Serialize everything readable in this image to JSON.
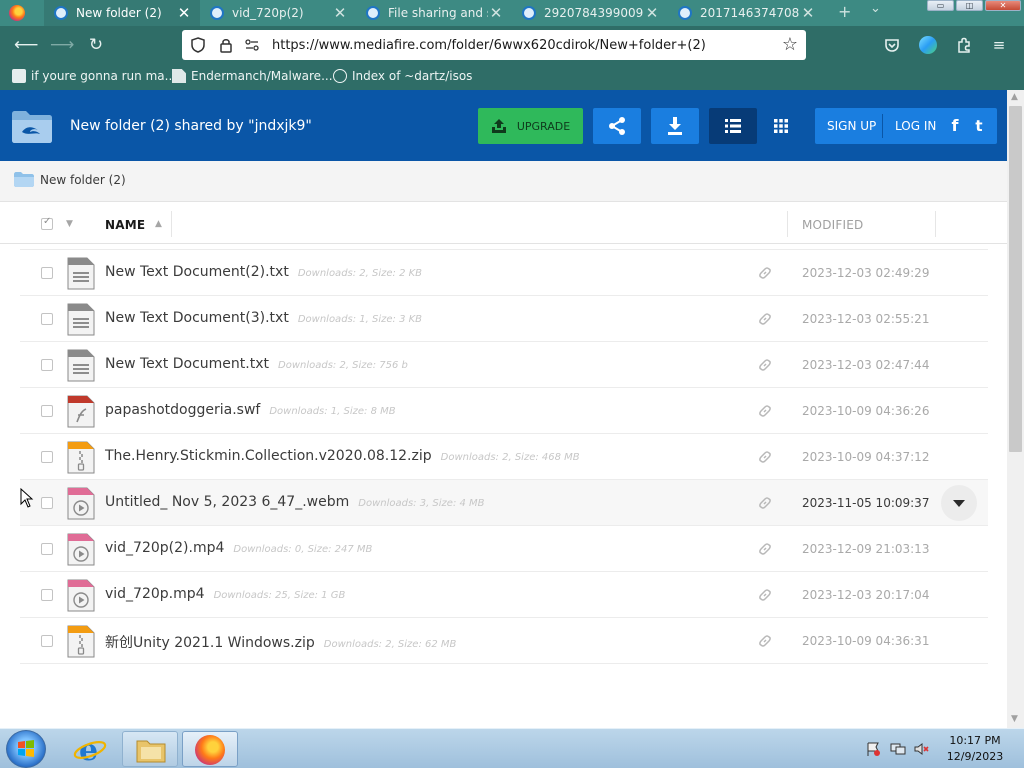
{
  "browser": {
    "tabs": [
      {
        "label": "New folder (2)",
        "active": true
      },
      {
        "label": "vid_720p(2)",
        "active": false
      },
      {
        "label": "File sharing and st",
        "active": false
      },
      {
        "label": "2920784399009",
        "active": false
      },
      {
        "label": "2017146374708",
        "active": false
      }
    ],
    "new_tab": "+",
    "tab_list": "⌄",
    "url": "https://www.mediafire.com/folder/6wwx620cdirok/New+folder+(2)",
    "bookmarks": [
      {
        "label": "if youre gonna run ma..."
      },
      {
        "label": "Endermanch/Malware..."
      },
      {
        "label": "Index of ~dartz/isos"
      }
    ],
    "window_buttons": {
      "minimize": "▭",
      "maximize": "◫",
      "close": "✕"
    }
  },
  "header": {
    "title": "New folder (2)   shared by \"jndxjk9\"",
    "upgrade_label": "UPGRADE",
    "sign_up": "SIGN UP",
    "log_in": "LOG IN",
    "facebook": "f",
    "twitter": "t"
  },
  "breadcrumb": {
    "label": "New folder (2)"
  },
  "columns": {
    "name": "NAME",
    "modified": "MODIFIED"
  },
  "files": [
    {
      "name": "New Text Document(2).txt",
      "meta": "Downloads: 2, Size: 2 KB",
      "modified": "2023-12-03 02:49:29",
      "type": "txt"
    },
    {
      "name": "New Text Document(3).txt",
      "meta": "Downloads: 1, Size: 3 KB",
      "modified": "2023-12-03 02:55:21",
      "type": "txt"
    },
    {
      "name": "New Text Document.txt",
      "meta": "Downloads: 2, Size: 756 b",
      "modified": "2023-12-03 02:47:44",
      "type": "txt"
    },
    {
      "name": "papashotdoggeria.swf",
      "meta": "Downloads: 1, Size: 8 MB",
      "modified": "2023-10-09 04:36:26",
      "type": "swf"
    },
    {
      "name": "The.Henry.Stickmin.Collection.v2020.08.12.zip",
      "meta": "Downloads: 2, Size: 468 MB",
      "modified": "2023-10-09 04:37:12",
      "type": "zip"
    },
    {
      "name": "Untitled_ Nov 5, 2023 6_47_.webm",
      "meta": "Downloads: 3, Size: 4 MB",
      "modified": "2023-11-05 10:09:37",
      "type": "video"
    },
    {
      "name": "vid_720p(2).mp4",
      "meta": "Downloads: 0, Size: 247 MB",
      "modified": "2023-12-09 21:03:13",
      "type": "video"
    },
    {
      "name": "vid_720p.mp4",
      "meta": "Downloads: 25, Size: 1 GB",
      "modified": "2023-12-03 20:17:04",
      "type": "video"
    },
    {
      "name": "新创Unity 2021.1 Windows.zip",
      "meta": "Downloads: 2, Size: 62 MB",
      "modified": "2023-10-09 04:36:31",
      "type": "zip"
    }
  ],
  "taskbar": {
    "time": "10:17 PM",
    "date": "12/9/2023"
  },
  "colors": {
    "mediafire_blue": "#0a56a7",
    "button_blue": "#1a7ee0",
    "upgrade_green": "#2fb95b",
    "browser_teal": "#2f6d67"
  }
}
